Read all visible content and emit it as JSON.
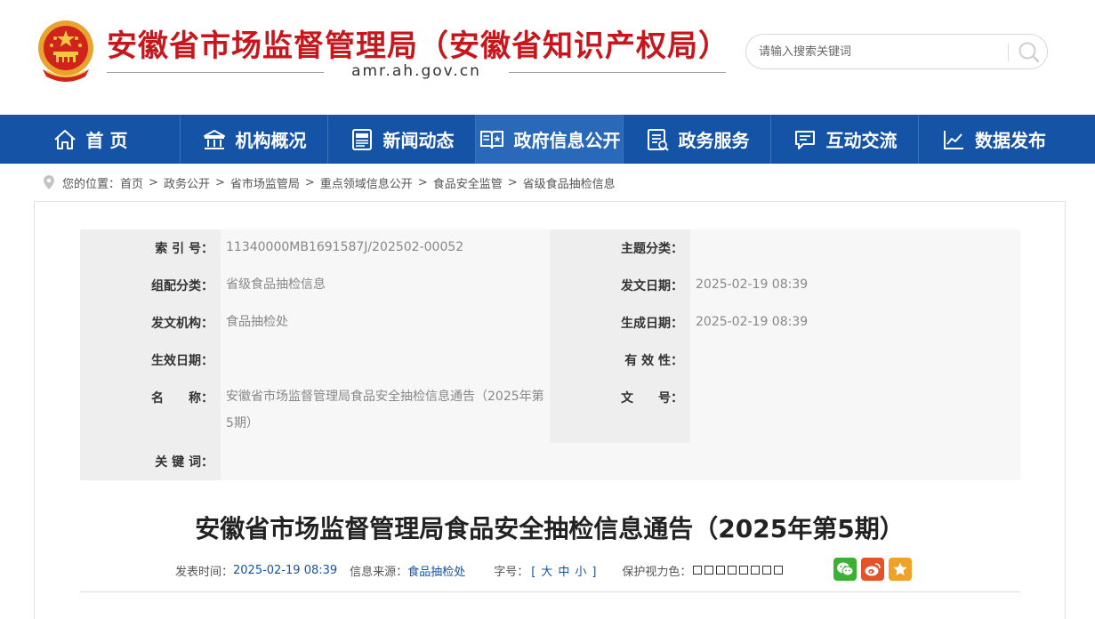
{
  "header": {
    "site_title": "安徽省市场监督管理局（安徽省知识产权局）",
    "domain": "amr.ah.gov.cn",
    "search_placeholder": "请输入搜索关键词",
    "brand_red": "#c8161d"
  },
  "nav": {
    "bg_color": "#1553a6",
    "items": [
      {
        "label": "首 页",
        "icon": "home-icon"
      },
      {
        "label": "机构概况",
        "icon": "building-icon"
      },
      {
        "label": "新闻动态",
        "icon": "news-icon"
      },
      {
        "label": "政府信息公开",
        "icon": "open-book-icon",
        "active": true
      },
      {
        "label": "政务服务",
        "icon": "service-doc-icon"
      },
      {
        "label": "互动交流",
        "icon": "chat-icon"
      },
      {
        "label": "数据发布",
        "icon": "chart-icon"
      }
    ]
  },
  "breadcrumb": {
    "prefix": "您的位置：",
    "items": [
      "首页",
      "政务公开",
      "省市场监管局",
      "重点领域信息公开",
      "食品安全监管",
      "省级食品抽检信息"
    ],
    "separator": ">"
  },
  "meta": {
    "index_label": "索 引 号：",
    "index_value": "11340000MB1691587J/202502-00052",
    "topic_label": "主题分类：",
    "topic_value": "",
    "group_label": "组配分类：",
    "group_value": "省级食品抽检信息",
    "pub_date_label": "发文日期：",
    "pub_date_value": "2025-02-19 08:39",
    "org_label": "发文机构：",
    "org_value": "食品抽检处",
    "gen_date_label": "生成日期：",
    "gen_date_value": "2025-02-19 08:39",
    "eff_date_label": "生效日期：",
    "eff_date_value": "",
    "validity_label": "有 效 性：",
    "validity_value": "",
    "name_label": "名　　称：",
    "name_value": "安徽省市场监督管理局食品安全抽检信息通告（2025年第5期）",
    "doc_no_label": "文　　号：",
    "doc_no_value": "",
    "keywords_label": "关 键 词：",
    "keywords_value": ""
  },
  "article": {
    "title": "安徽省市场监督管理局食品安全抽检信息通告（2025年第5期）",
    "pub_time_label": "发表时间：",
    "pub_time_value": "2025-02-19 08:39",
    "source_label": "信息来源：",
    "source_value": "食品抽检处",
    "font_label": "字号：",
    "font_open": "[",
    "font_large": "大",
    "font_medium": "中",
    "font_small": "小",
    "font_close": "]",
    "eye_label": "保护视力色："
  },
  "share": {
    "wechat_color": "#3cb034",
    "weibo_color": "#e2532a",
    "favorite_color": "#f0a128"
  }
}
